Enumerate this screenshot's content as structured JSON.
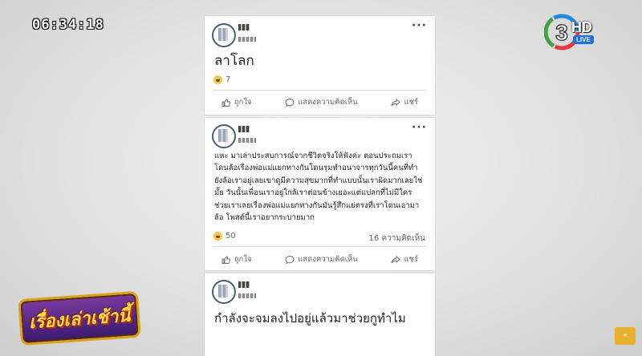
{
  "overlay": {
    "timestamp": "06:34:18",
    "channel_number": "3",
    "channel_hd": "HD",
    "channel_live": "LIVE",
    "program_title": "เรื่องเล่าเช้านี้"
  },
  "posts": [
    {
      "body": "ลาโลก",
      "reaction_count": "7",
      "comment_count": "",
      "actions": {
        "like": "ถูกใจ",
        "comment": "แสดงความคิดเห็น",
        "share": "แชร์"
      }
    },
    {
      "body": "แหะ มาเล่าประสบการณ์จากชีวิตจริงให้ฟังค่ะ ตอนประถมเราโดนล้อเรื่องพ่อแม่แยกทางกันโดนรุมทำอนาจารทุกวันนี้คนที่ทำยังล้อเราอยู่เลยเขาดูมีความสุขมากที่ทำแบบนั้นเราผิดมากเลยใช่มั้ย วันนั้นเพื่อนเราอยู่ใกล้เราต่อนข้างเยอะแต่แปลกที่ไม่มีใครช่วยเราเลยเรื่องพ่อแม่แยกทางกันมันรู้สึกแย่ตรงที่เราโดนเอามาล้อ โพสต์นี้เราอยากระบายมาก",
      "reaction_count": "50",
      "comment_count": "16 ความคิดเห็น",
      "actions": {
        "like": "ถูกใจ",
        "comment": "แสดงความคิดเห็น",
        "share": "แชร์"
      }
    },
    {
      "body": "กำลังจะจมลงไปอยู่แล้วมาช่วยกูทำไม"
    }
  ],
  "colors": {
    "post_bg": "#ffffff",
    "text": "#1c1e21",
    "meta": "#65676b",
    "divider": "#dadde1"
  }
}
